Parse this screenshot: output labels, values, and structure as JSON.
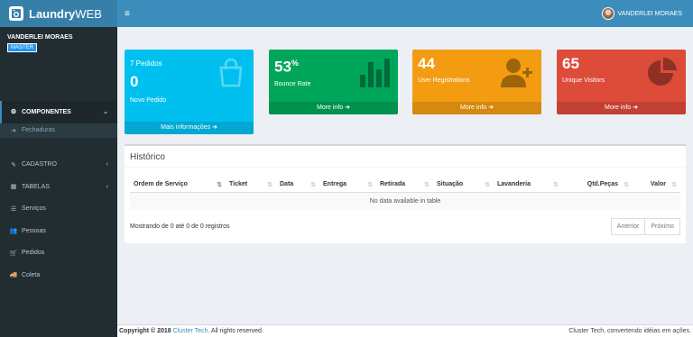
{
  "app": {
    "title_bold": "Laundry",
    "title_rest": "WEB"
  },
  "user": {
    "name": "VANDERLEI MORAES",
    "role": "MASTER",
    "nav_name": "VANDERLEI MORAES"
  },
  "sidebar": {
    "items": [
      {
        "label": "COMPONENTES",
        "icon": "cogs-icon"
      },
      {
        "label": "Fechaduras",
        "icon": "arrow-circle-right-icon"
      },
      {
        "label": "CADASTRO",
        "icon": "edit-icon"
      },
      {
        "label": "TABELAS",
        "icon": "table-icon"
      },
      {
        "label": "Serviços",
        "icon": "list-icon"
      },
      {
        "label": "Pessoas",
        "icon": "users-icon"
      },
      {
        "label": "Pedidos",
        "icon": "cart-icon"
      },
      {
        "label": "Coleta",
        "icon": "truck-icon"
      }
    ]
  },
  "boxes": {
    "orders": {
      "title": "7 Pedidos",
      "value": "0",
      "label": "Novo Pedido",
      "footer": "Mais informações"
    },
    "bounce": {
      "value": "53",
      "suffix": "%",
      "label": "Bounce Rate",
      "footer": "More info"
    },
    "registrations": {
      "value": "44",
      "label": "User Registrations",
      "footer": "More info"
    },
    "visitors": {
      "value": "65",
      "label": "Unique Visitors",
      "footer": "More info"
    }
  },
  "historico": {
    "title": "Histórico",
    "columns": [
      "Ordem de Serviço",
      "Ticket",
      "Data",
      "Entrega",
      "Retirada",
      "Situação",
      "Lavanderia",
      "Qtd.Peças",
      "Valor"
    ],
    "empty": "No data available in table",
    "info": "Mostrando de 0 até 0 de 0 registros",
    "prev": "Anterior",
    "next": "Próximo"
  },
  "footer": {
    "copyright": "Copyright © 2018",
    "company": "Cluster Tech",
    "rights": ". All rights reserved.",
    "tagline": "Cluster Tech, convertendo idéias em ações."
  },
  "colors": {
    "header": "#3c8dbc",
    "logo": "#367fa9",
    "sidebar": "#222d32",
    "aqua": "#00c0ef",
    "green": "#00a65a",
    "yellow": "#f39c12",
    "red": "#dd4b39"
  }
}
